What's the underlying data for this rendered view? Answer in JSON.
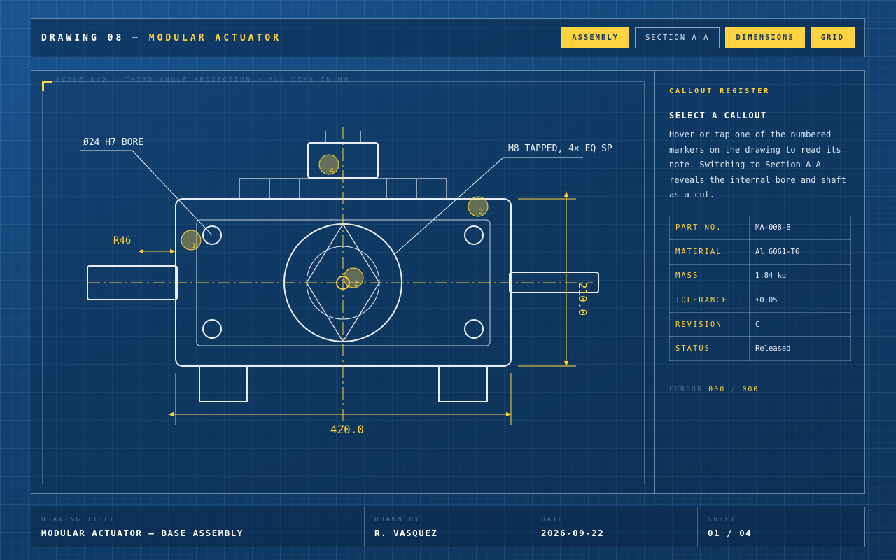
{
  "header": {
    "title_prefix": "DRAWING 08 —",
    "title_accent": "MODULAR ACTUATOR",
    "buttons": {
      "assembly": "ASSEMBLY",
      "section": "SECTION A–A",
      "dimensions": "DIMENSIONS",
      "grid": "GRID"
    }
  },
  "drawing": {
    "scale_note": "SCALE 1:2 · THIRD-ANGLE PROJECTION · ALL DIMS IN MM",
    "labels": {
      "bore": "Ø24 H7 BORE",
      "tapped": "M8 TAPPED, 4× EQ SP",
      "radius": "R46",
      "width": "420.0",
      "height": "210.0"
    },
    "markers": [
      "1",
      "2",
      "3",
      "4"
    ]
  },
  "side": {
    "eyebrow": "CALLOUT REGISTER",
    "heading": "SELECT A CALLOUT",
    "description": "Hover or tap one of the numbered markers on the drawing to read its note. Switching to Section A–A reveals the internal bore and shaft as a cut.",
    "specs": [
      {
        "key": "PART NO.",
        "value": "MA-008-B"
      },
      {
        "key": "MATERIAL",
        "value": "Al 6061-T6"
      },
      {
        "key": "MASS",
        "value": "1.84 kg"
      },
      {
        "key": "TOLERANCE",
        "value": "±0.05"
      },
      {
        "key": "REVISION",
        "value": "C"
      },
      {
        "key": "STATUS",
        "value": "Released"
      }
    ],
    "cursor": {
      "label": "CURSOR",
      "x": "000",
      "sep": "/",
      "y": "000"
    }
  },
  "footer": {
    "title_label": "DRAWING TITLE",
    "title_value": "MODULAR ACTUATOR — BASE ASSEMBLY",
    "drawn_label": "DRAWN BY",
    "drawn_value": "R. VASQUEZ",
    "date_label": "DATE",
    "date_value": "2026-09-22",
    "sheet_label": "SHEET",
    "sheet_value": "01 / 04"
  },
  "colors": {
    "accent": "#ffd23f",
    "line": "#e8eef6",
    "background": "#12406e"
  }
}
